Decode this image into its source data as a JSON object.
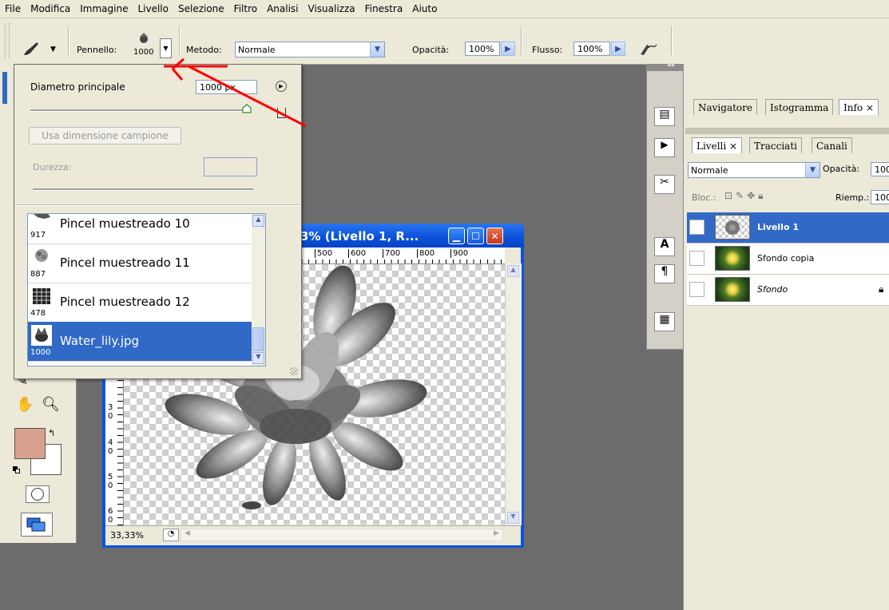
{
  "menu": [
    "File",
    "Modifica",
    "Immagine",
    "Livello",
    "Selezione",
    "Filtro",
    "Analisi",
    "Visualizza",
    "Finestra",
    "Aiuto"
  ],
  "options_bar": {
    "brush_label": "Pennello:",
    "brush_size": "1000",
    "mode_label": "Metodo:",
    "mode_value": "Normale",
    "opacity_label": "Opacità:",
    "opacity_value": "100%",
    "flow_label": "Flusso:",
    "flow_value": "100%"
  },
  "brush_popup": {
    "diameter_label": "Diametro principale",
    "diameter_value": "1000 px",
    "diameter_fraction": 1.0,
    "sample_button": "Usa dimensione campione",
    "hardness_label": "Durezza:",
    "brushes": [
      {
        "name": "Pincel muestreado 10",
        "size": "917"
      },
      {
        "name": "Pincel muestreado 11",
        "size": "887"
      },
      {
        "name": "Pincel muestreado 12",
        "size": "478"
      },
      {
        "name": "Water_lily.jpg",
        "size": "1000"
      }
    ],
    "selected_index": 3
  },
  "document": {
    "title": "3% (Livello 1, R...",
    "ruler_h": [
      "500",
      "600",
      "700",
      "800",
      "900"
    ],
    "ruler_v": [
      "3",
      "0",
      "4",
      "0",
      "5",
      "0",
      "6",
      "0"
    ],
    "zoom": "33,33%"
  },
  "panels": {
    "top_tabs": [
      "Navigatore",
      "Istogramma",
      "Info"
    ],
    "layer_tabs": [
      "Livelli",
      "Tracciati",
      "Canali"
    ],
    "blend_mode": "Normale",
    "opacity_label": "Opacità:",
    "opacity_value": "100",
    "lock_label": "Bloc.:",
    "fill_label": "Riemp.:",
    "fill_value": "100",
    "layers": [
      {
        "name": "Livello 1",
        "selected": true
      },
      {
        "name": "Sfondo copia",
        "selected": false
      },
      {
        "name": "Sfondo",
        "selected": false
      }
    ]
  },
  "colors": {
    "foreground": "#d7a18e",
    "background": "#ffffff",
    "selection": "#3169c6",
    "annotation": "#ff0000"
  }
}
